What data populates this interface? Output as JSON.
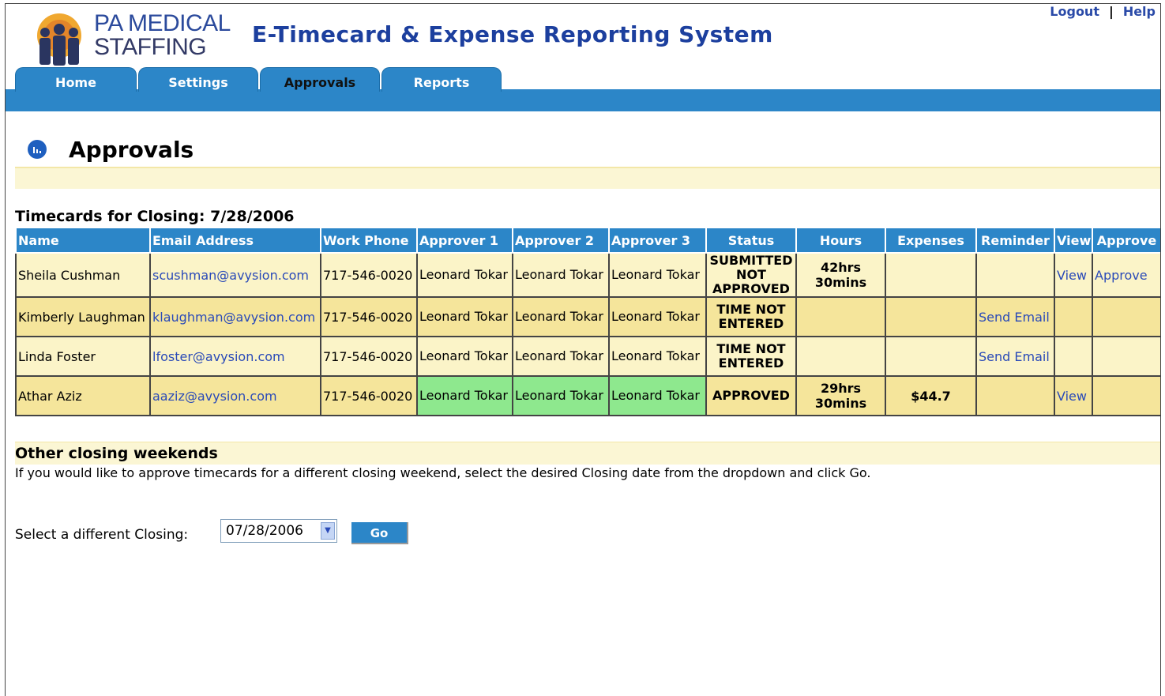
{
  "header": {
    "logo_line1": "PA MEDICAL",
    "logo_line2": "STAFFING",
    "app_title": "E-Timecard & Expense Reporting System",
    "logout": "Logout",
    "separator": "|",
    "help": "Help"
  },
  "tabs": [
    {
      "label": "Home",
      "active": false
    },
    {
      "label": "Settings",
      "active": false
    },
    {
      "label": "Approvals",
      "active": true
    },
    {
      "label": "Reports",
      "active": false
    }
  ],
  "page": {
    "title": "Approvals",
    "section_title": "Timecards for Closing: 7/28/2006"
  },
  "table": {
    "columns": [
      "Name",
      "Email Address",
      "Work Phone",
      "Approver 1",
      "Approver 2",
      "Approver 3",
      "Status",
      "Hours",
      "Expenses",
      "Reminder",
      "View",
      "Approve"
    ],
    "rows": [
      {
        "name": "Sheila Cushman",
        "email": "scushman@avysion.com",
        "phone": "717-546-0020",
        "approver1": "Leonard Tokar",
        "approver2": "Leonard Tokar",
        "approver3": "Leonard Tokar",
        "status": "SUBMITTED NOT APPROVED",
        "hours": "42hrs 30mins",
        "expenses": "",
        "reminder": "",
        "view": "View",
        "approve": "Approve"
      },
      {
        "name": "Kimberly Laughman",
        "email": "klaughman@avysion.com",
        "phone": "717-546-0020",
        "approver1": "Leonard Tokar",
        "approver2": "Leonard Tokar",
        "approver3": "Leonard Tokar",
        "status": "TIME NOT ENTERED",
        "hours": "",
        "expenses": "",
        "reminder": "Send Email",
        "view": "",
        "approve": ""
      },
      {
        "name": "Linda Foster",
        "email": "lfoster@avysion.com",
        "phone": "717-546-0020",
        "approver1": "Leonard Tokar",
        "approver2": "Leonard Tokar",
        "approver3": "Leonard Tokar",
        "status": "TIME NOT ENTERED",
        "hours": "",
        "expenses": "",
        "reminder": "Send Email",
        "view": "",
        "approve": ""
      },
      {
        "name": "Athar Aziz",
        "email": "aaziz@avysion.com",
        "phone": "717-546-0020",
        "approver1": "Leonard Tokar",
        "approver2": "Leonard Tokar",
        "approver3": "Leonard Tokar",
        "status": "APPROVED",
        "hours": "29hrs 30mins",
        "expenses": "$44.7",
        "reminder": "",
        "view": "View",
        "approve": ""
      }
    ]
  },
  "other": {
    "title": "Other closing weekends",
    "description": "If you would like to approve timecards for a different closing weekend, select the desired Closing date from the dropdown and click Go.",
    "select_label": "Select a different Closing:",
    "selected_value": "07/28/2006",
    "go_label": "Go"
  },
  "colors": {
    "brand_blue": "#2c86c8",
    "row_light": "#fbf4c8",
    "row_dark": "#f5e59b",
    "approved_green": "#8ee88e",
    "link": "#2a4ab8"
  }
}
